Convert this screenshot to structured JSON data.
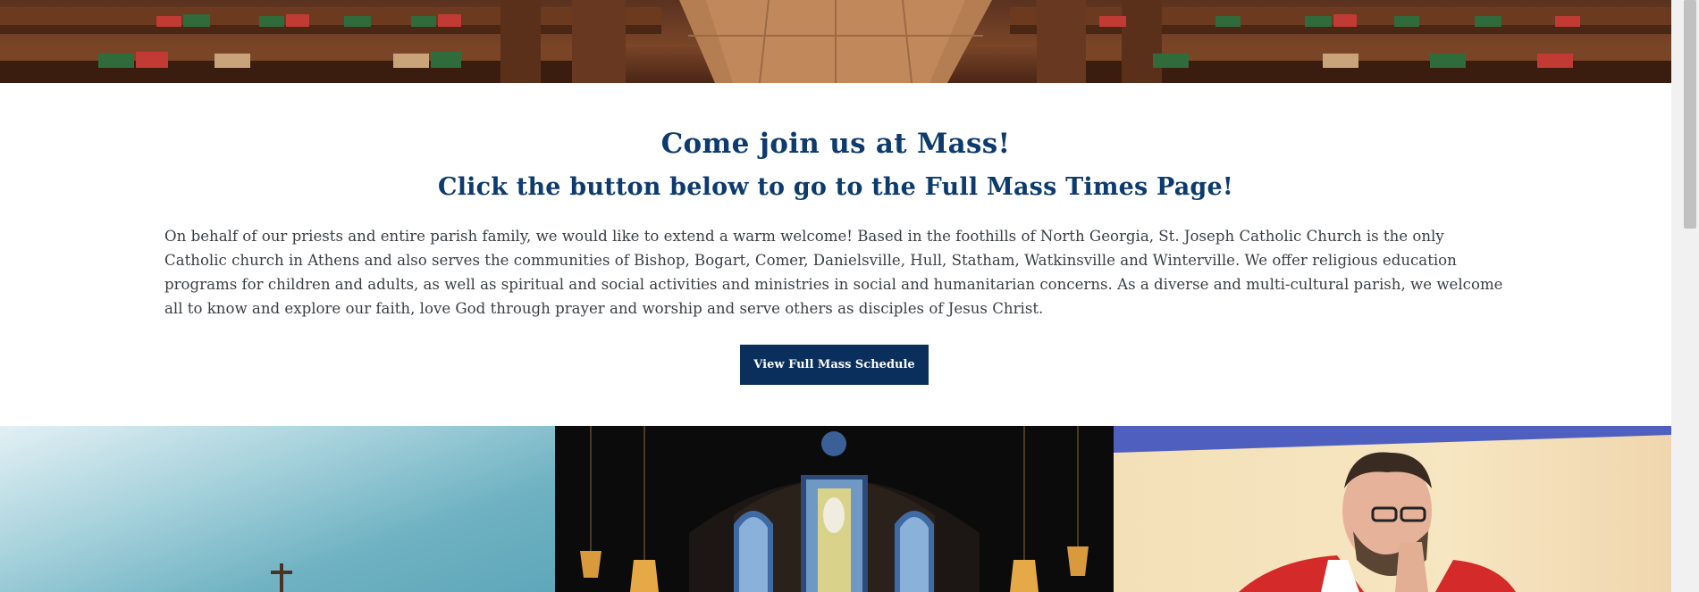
{
  "hero": {
    "image": "church-pews-with-hymnals"
  },
  "welcome": {
    "heading": "Come join us at Mass!",
    "subheading": "Click the button below to go to the Full Mass Times Page!",
    "body": "On behalf of our priests and entire parish family, we would like to extend a warm welcome! Based in the foothills of North Georgia, St. Joseph Catholic Church is the only Catholic church in Athens and also serves the communities of Bishop, Bogart, Comer, Danielsville, Hull, Statham, Watkinsville and Winterville. We offer religious education programs for children and adults, as well as spiritual and social activities and ministries in social and humanitarian concerns. As a diverse and multi-cultural parish, we welcome all to know and explore our faith, love God through prayer and worship and serve others as disciples of Jesus Christ.",
    "button_label": "View Full Mass Schedule"
  },
  "photos": [
    {
      "image": "church-steeple-cross-sky"
    },
    {
      "image": "church-interior-stained-glass"
    },
    {
      "image": "priest-praying"
    }
  ],
  "colors": {
    "heading": "#0d3b6e",
    "button_bg": "#0a2f5c",
    "body_text": "#3a3f44"
  }
}
